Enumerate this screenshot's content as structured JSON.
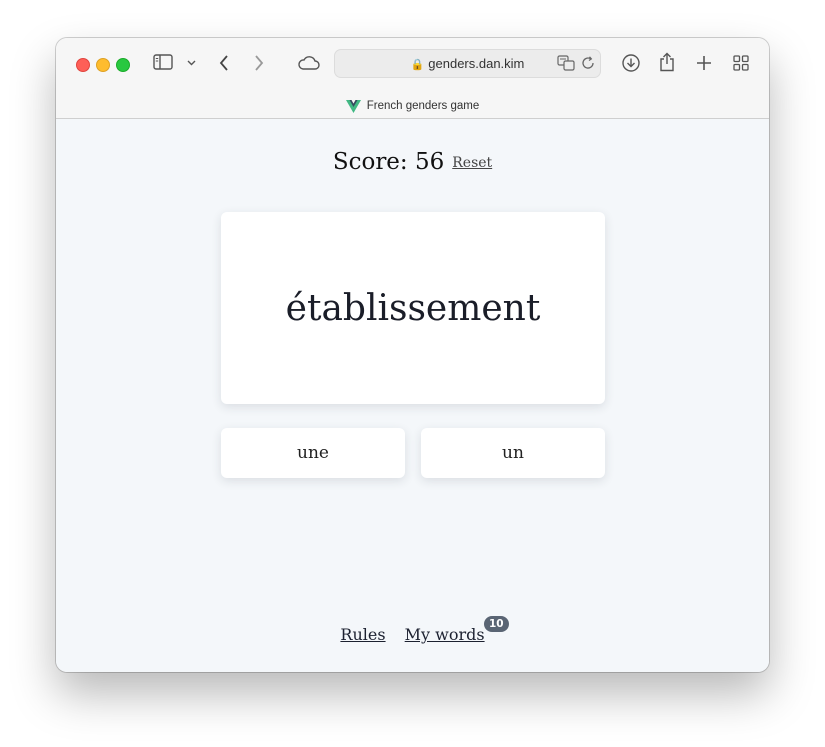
{
  "browser": {
    "url": "genders.dan.kim",
    "tab_title": "French genders game"
  },
  "game": {
    "score_label": "Score: 56",
    "reset_label": "Reset",
    "word": "établissement",
    "choices": [
      "une",
      "un"
    ]
  },
  "footer": {
    "rules_label": "Rules",
    "my_words_label": "My words",
    "my_words_count": "10"
  },
  "icons": {
    "tab_logo_color": "#41b883",
    "tab_logo_dark": "#35495e"
  }
}
